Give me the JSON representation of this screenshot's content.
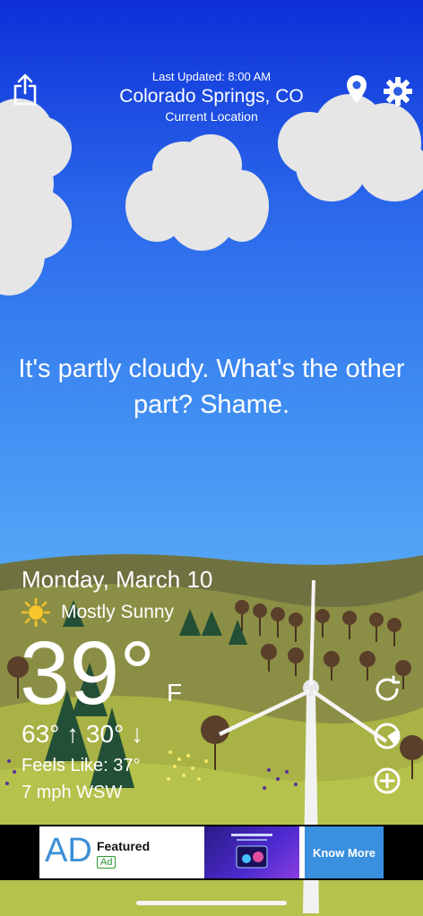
{
  "header": {
    "last_updated": "Last Updated: 8:00 AM",
    "location": "Colorado Springs, CO",
    "location_sub": "Current Location"
  },
  "icons": {
    "share": "share-icon",
    "pin": "location-pin-icon",
    "settings": "gear-icon",
    "refresh": "refresh-icon",
    "radar": "radar-icon",
    "add": "add-icon",
    "sun": "sun-icon"
  },
  "quip": "It's partly cloudy. What's the other part? Shame.",
  "current": {
    "date": "Monday, March 10",
    "condition": "Mostly Sunny",
    "temperature": "39°",
    "unit": "F",
    "high": "63° ↑",
    "low": "30° ↓",
    "feels_like": "Feels Like: 37°",
    "wind": "7 mph WSW"
  },
  "ad": {
    "logo": "AD",
    "title": "Featured",
    "badge": "Ad",
    "cta": "Know More"
  },
  "colors": {
    "sky_top": "#0d2fd8",
    "sky_bottom": "#55a6f6",
    "hill": "#8f9440",
    "ad_button": "#3a8fde"
  }
}
